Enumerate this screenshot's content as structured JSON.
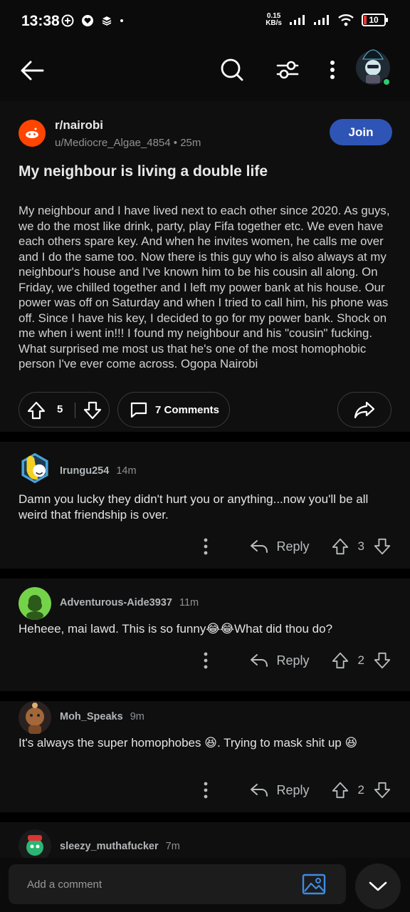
{
  "status_bar": {
    "time": "13:38",
    "net_speed_value": "0.15",
    "net_speed_unit": "KB/s",
    "battery": "10"
  },
  "top_bar": {
    "icons": [
      "back-arrow-icon",
      "search-icon",
      "filter-icon",
      "more-icon",
      "avatar"
    ]
  },
  "post": {
    "subreddit": "r/nairobi",
    "author": "u/Mediocre_Algae_4854",
    "time": "25m",
    "join_label": "Join",
    "title": "My neighbour is living a double life",
    "body": "My neighbour and I have lived next to each other since 2020. As guys, we do the most like drink, party, play Fifa together etc. We even have each others spare key. And when he invites women, he calls me over and I do the same too. Now there is this guy who is also always at my neighbour's house and I've known him to be his cousin all along. On Friday,  we chilled together and I left my power bank at his house. Our power was off on Saturday and when I tried to call him, his phone was off. Since I have his key, I decided to go for my power bank. Shock on me when i went in!!! I found my neighbour and his \"cousin\" fucking. What surprised me most us that he's one of the most homophobic person I've ever come across. Ogopa Nairobi",
    "votes": "5",
    "comments_label": "7 Comments"
  },
  "comments": [
    {
      "author": "Irungu254",
      "time": "14m",
      "text": "Damn you lucky they didn't hurt you or anything...now you'll be all weird that friendship is over.",
      "reply_label": "Reply",
      "votes": "3"
    },
    {
      "author": "Adventurous-Aide3937",
      "time": "11m",
      "text": "Heheee, mai lawd. This is so funny😂😂What did thou do?",
      "reply_label": "Reply",
      "votes": "2"
    },
    {
      "author": "Moh_Speaks",
      "time": "9m",
      "text": "It's always the super homophobes 😆. Trying to mask shit up 😆",
      "reply_label": "Reply",
      "votes": "2"
    },
    {
      "author": "sleezy_muthafucker",
      "time": "7m"
    }
  ],
  "comment_bar": {
    "placeholder": "Add a comment"
  },
  "colors": {
    "join_blue": "#2e55b5",
    "subreddit_orange": "#ff4500",
    "online_green": "#2ecc71"
  }
}
